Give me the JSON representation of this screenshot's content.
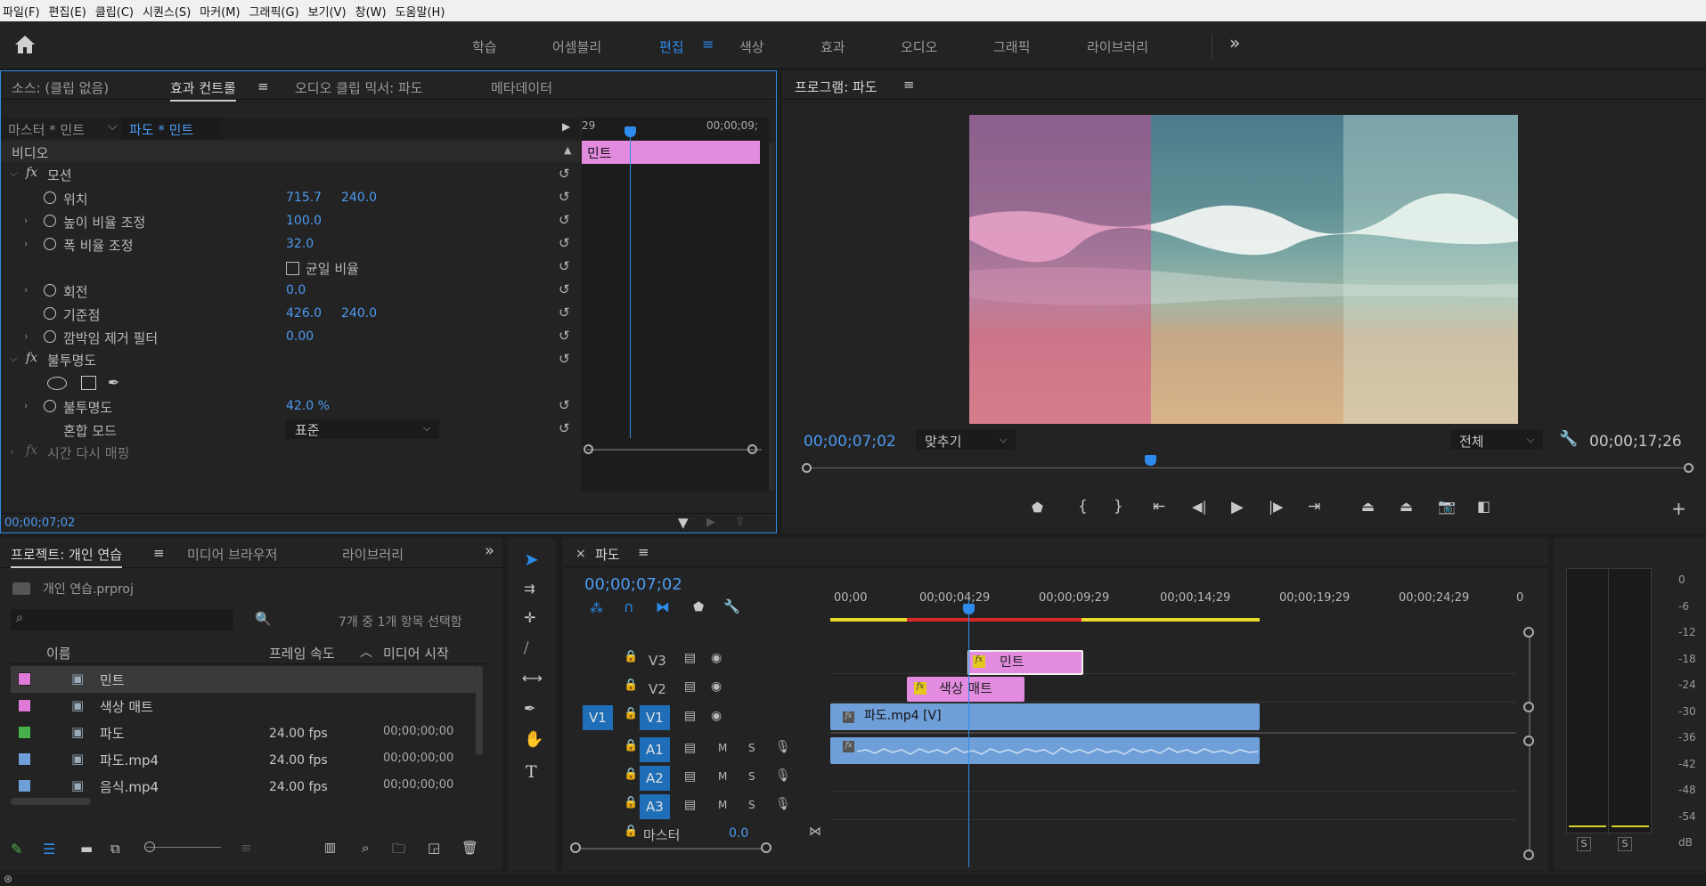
{
  "menubar": [
    "파일(F)",
    "편집(E)",
    "클립(C)",
    "시퀀스(S)",
    "마커(M)",
    "그래픽(G)",
    "보기(V)",
    "창(W)",
    "도움말(H)"
  ],
  "workspaces": {
    "items": [
      "학습",
      "어셈블리",
      "편집",
      "색상",
      "효과",
      "오디오",
      "그래픽",
      "라이브러리"
    ],
    "active": "편집",
    "more": "»"
  },
  "effect_panel": {
    "tabs": [
      "소스: (클립 없음)",
      "효과 컨트롤",
      "오디오 클립 믹서: 파도",
      "메타데이터"
    ],
    "active_tab": "효과 컨트롤",
    "master": "마스터 * 민트",
    "clip": "파도 * 민트",
    "ruler_start": "29",
    "ruler_end": "00;00;09;",
    "clip_bar_label": "민트",
    "section_video": "비디오",
    "motion": "모션",
    "position_label": "위치",
    "position_x": "715.7",
    "position_y": "240.0",
    "height_scale_label": "높이 비율 조정",
    "height_scale": "100.0",
    "width_scale_label": "폭 비율 조정",
    "width_scale": "32.0",
    "uniform_scale_label": "균일 비율",
    "rotation_label": "회전",
    "rotation": "0.0",
    "anchor_label": "기준점",
    "anchor_x": "426.0",
    "anchor_y": "240.0",
    "flicker_label": "깜박임 제거 필터",
    "flicker": "0.00",
    "opacity_section": "불투명도",
    "opacity_label": "불투명도",
    "opacity": "42.0 %",
    "blend_label": "혼합 모드",
    "blend": "표준",
    "time_remap": "시간 다시 매핑",
    "timecode": "00;00;07;02"
  },
  "program": {
    "title": "프로그램: 파도",
    "timecode": "00;00;07;02",
    "fit": "맞추기",
    "quality": "전체",
    "duration": "00;00;17;26",
    "playhead_fraction": 0.39
  },
  "project": {
    "tabs": [
      "프로젝트: 개인 연습",
      "미디어 브라우저",
      "라이브러리"
    ],
    "file": "개인 연습.prproj",
    "selection": "7개 중 1개 항목 선택함",
    "columns": {
      "name": "이름",
      "fps": "프레임 속도",
      "start": "미디어 시작"
    },
    "items": [
      {
        "color": "#e07ad8",
        "name": "민트",
        "fps": "",
        "start": ""
      },
      {
        "color": "#e07ad8",
        "name": "색상 매트",
        "fps": "",
        "start": ""
      },
      {
        "color": "#46b04a",
        "name": "파도",
        "fps": "24.00 fps",
        "start": "00;00;00;00"
      },
      {
        "color": "#6f9fd8",
        "name": "파도.mp4",
        "fps": "24.00 fps",
        "start": "00;00;00;00"
      },
      {
        "color": "#6f9fd8",
        "name": "음식.mp4",
        "fps": "24.00 fps",
        "start": "00;00;00;00"
      }
    ]
  },
  "timeline": {
    "title": "파도",
    "timecode": "00;00;07;02",
    "ruler": [
      "00;00",
      "00;00;04;29",
      "00;00;09;29",
      "00;00;14;29",
      "00;00;19;29",
      "00;00;24;29",
      "0"
    ],
    "tracks": {
      "v3": "V3",
      "v2": "V2",
      "v1": "V1",
      "v1_source": "V1",
      "a1": "A1",
      "a2": "A2",
      "a3": "A3",
      "master": "마스터",
      "master_vol": "0.0",
      "m": "M",
      "s": "S"
    },
    "clips": {
      "mint": "민트",
      "matte": "색상 매트",
      "video": "파도.mp4 [V]",
      "fx": "fx"
    }
  },
  "meter": {
    "labels": [
      "0",
      "-6",
      "-12",
      "-18",
      "-24",
      "-30",
      "-36",
      "-42",
      "-48",
      "-54",
      "dB"
    ],
    "solo": "S"
  }
}
